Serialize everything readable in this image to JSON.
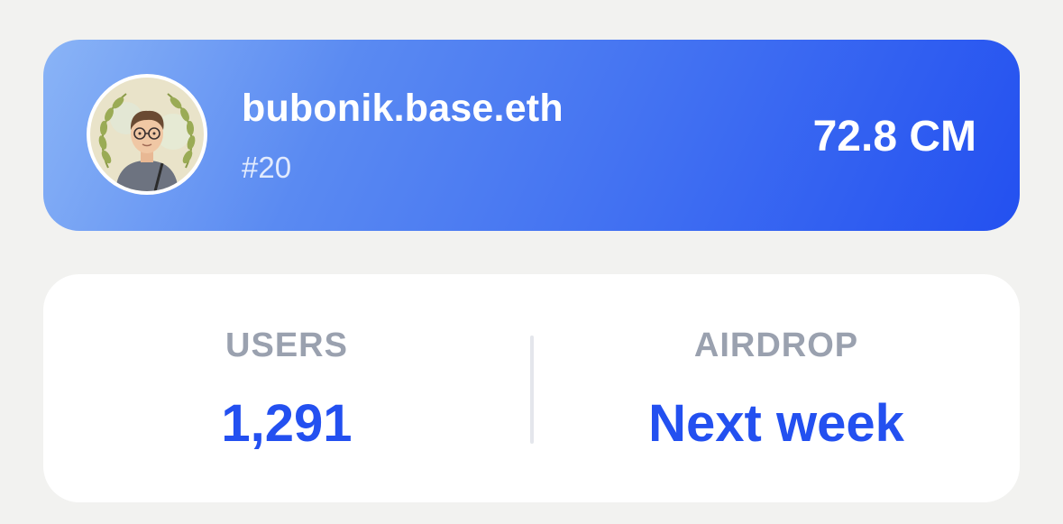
{
  "profile": {
    "username": "bubonik.base.eth",
    "rank": "#20",
    "score": "72.8 CM",
    "avatar_icon": "avatar-illustration-laurel-wreath"
  },
  "stats": {
    "users": {
      "label": "USERS",
      "value": "1,291"
    },
    "airdrop": {
      "label": "AIRDROP",
      "value": "Next week"
    }
  },
  "colors": {
    "accent": "#2350f0",
    "gradient_start": "#8ab4f6",
    "gradient_end": "#2350f0",
    "label_gray": "#9aa1af",
    "background": "#f2f2f0"
  }
}
